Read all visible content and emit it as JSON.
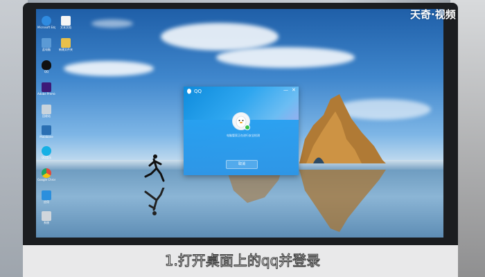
{
  "watermark": "天奇·视频",
  "caption": "1.打开桌面上的qq并登录",
  "desktop_icons": [
    {
      "label": "Microsoft Edge",
      "color": "#2f8be0"
    },
    {
      "label": "此电脑",
      "color": "#5b9ad5"
    },
    {
      "label": "QQ",
      "color": "#111111"
    },
    {
      "label": "Adobe Premiere",
      "color": "#3d1a78"
    },
    {
      "label": "回收站",
      "color": "#c8d3dc"
    },
    {
      "label": "Malabane",
      "color": "#2a6fb3"
    },
    {
      "label": "QQ音乐",
      "color": "#16b0e5"
    },
    {
      "label": "Google Chrome",
      "color": "#e24b3b"
    },
    {
      "label": "应用",
      "color": "#2b8fdd"
    },
    {
      "label": "系统",
      "color": "#d0d6dc"
    },
    {
      "label": "文本文档",
      "color": "#f5f5f5"
    },
    {
      "label": "新建文件夹",
      "color": "#e8c04a"
    }
  ],
  "qq": {
    "title": "QQ",
    "minimize": "—",
    "close": "✕",
    "message": "电脑管家正在进行安全检测",
    "login_label": "取消",
    "accent": "#2e96e6"
  }
}
